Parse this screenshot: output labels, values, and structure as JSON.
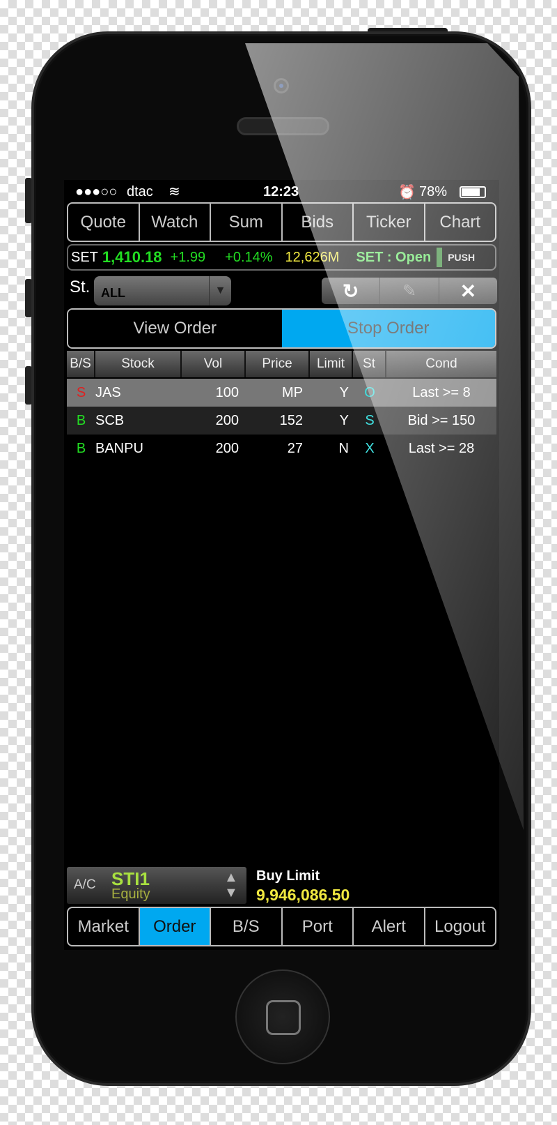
{
  "status_bar": {
    "signal": "●●●○○",
    "carrier": "dtac",
    "time": "12:23",
    "battery": "78%"
  },
  "top_tabs": [
    "Quote",
    "Watch",
    "Sum",
    "Bids",
    "Ticker",
    "Chart"
  ],
  "ticker": {
    "index": "SET",
    "value": "1,410.18",
    "change": "+1.99",
    "pct": "+0.14%",
    "volume": "12,626M",
    "market_status": "SET : Open",
    "push_label": "PUSH"
  },
  "filter": {
    "label": "St.",
    "value": "ALL"
  },
  "toolbar_icons": [
    "refresh-icon",
    "pencil-icon",
    "close-icon"
  ],
  "toggle": {
    "view": "View Order",
    "stop": "Stop Order",
    "active": "stop"
  },
  "table": {
    "headers": [
      "B/S",
      "Stock",
      "Vol",
      "Price",
      "Limit",
      "St",
      "Cond"
    ],
    "rows": [
      {
        "side": "S",
        "stock": "JAS",
        "vol": "100",
        "price": "MP",
        "limit": "Y",
        "st": "O",
        "cond": "Last >= 8"
      },
      {
        "side": "B",
        "stock": "SCB",
        "vol": "200",
        "price": "152",
        "limit": "Y",
        "st": "S",
        "cond": "Bid >= 150"
      },
      {
        "side": "B",
        "stock": "BANPU",
        "vol": "200",
        "price": "27",
        "limit": "N",
        "st": "X",
        "cond": "Last >= 28"
      }
    ]
  },
  "account": {
    "label": "A/C",
    "id": "STI1",
    "type": "Equity",
    "limit_label": "Buy Limit",
    "limit_value": "9,946,086.50"
  },
  "bottom_tabs": [
    "Market",
    "Order",
    "B/S",
    "Port",
    "Alert",
    "Logout"
  ],
  "active_bottom_tab": "Order",
  "colors": {
    "accent": "#00a8f0",
    "green": "#22dd22",
    "yellow": "#f0e840",
    "red": "#e02020",
    "cyan": "#40e0e0"
  }
}
